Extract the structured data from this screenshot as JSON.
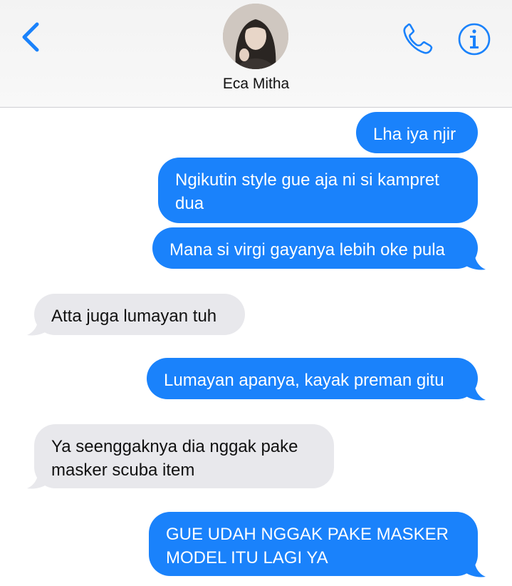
{
  "header": {
    "contact_name": "Eca Mitha",
    "back_icon": "chevron-left-icon",
    "call_icon": "phone-icon",
    "info_icon": "info-icon",
    "accent_color": "#1a82fb"
  },
  "messages": [
    {
      "from": "me",
      "text": "Lha iya njir"
    },
    {
      "from": "me",
      "text": "Ngikutin style gue aja ni si kampret dua"
    },
    {
      "from": "me",
      "text": "Mana si virgi gayanya lebih oke pula"
    },
    {
      "from": "them",
      "text": "Atta juga lumayan tuh"
    },
    {
      "from": "me",
      "text": "Lumayan apanya, kayak preman gitu"
    },
    {
      "from": "them",
      "text": "Ya seenggaknya dia nggak pake masker scuba item"
    },
    {
      "from": "me",
      "text": "GUE UDAH NGGAK PAKE MASKER MODEL ITU LAGI YA"
    }
  ],
  "colors": {
    "outgoing_bubble": "#1a82fb",
    "incoming_bubble": "#e8e8ec"
  }
}
